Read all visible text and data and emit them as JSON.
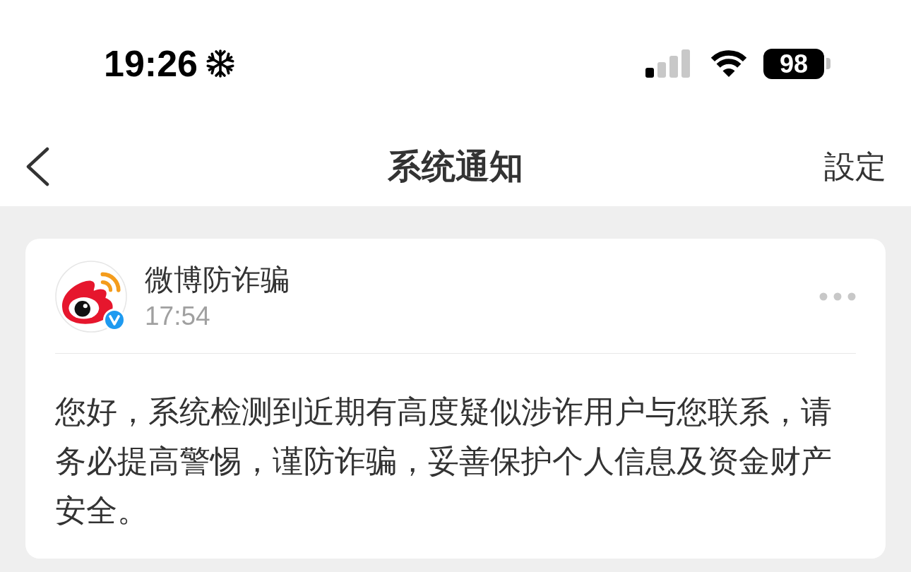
{
  "status_bar": {
    "time": "19:26",
    "battery": "98"
  },
  "nav_bar": {
    "title": "系统通知",
    "action": "設定"
  },
  "notifications": [
    {
      "sender": "微博防诈骗",
      "verified": true,
      "time": "17:54",
      "message": "您好，系统检测到近期有高度疑似涉诈用户与您联系，请务必提高警惕，谨防诈骗，妥善保护个人信息及资金财产安全。"
    }
  ]
}
